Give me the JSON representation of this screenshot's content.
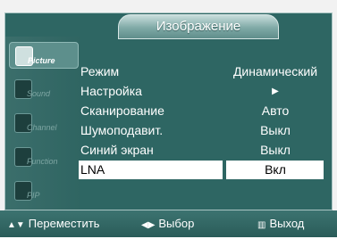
{
  "menu": {
    "title": "Изображение",
    "items": [
      {
        "label": "Режим",
        "value": "Динамический"
      },
      {
        "label": "Настройка",
        "value": "▶"
      },
      {
        "label": "Сканирование",
        "value": "Авто"
      },
      {
        "label": "Шумоподавит.",
        "value": "Выкл"
      },
      {
        "label": "Синий экран",
        "value": "Выкл"
      },
      {
        "label": "LNA",
        "value": "Вкл"
      }
    ]
  },
  "sidebar": {
    "items": [
      {
        "label": "Picture",
        "icon": "picture-icon"
      },
      {
        "label": "Sound",
        "icon": "sound-icon"
      },
      {
        "label": "Channel",
        "icon": "channel-icon"
      },
      {
        "label": "Function",
        "icon": "function-icon"
      },
      {
        "label": "PIP",
        "icon": "pip-icon"
      }
    ]
  },
  "footer": {
    "move_label": "Переместить",
    "select_label": "Выбор",
    "exit_label": "Выход"
  },
  "colors": {
    "panel": "#2e6663",
    "highlight": "#ffffff",
    "text": "#ffffff"
  }
}
